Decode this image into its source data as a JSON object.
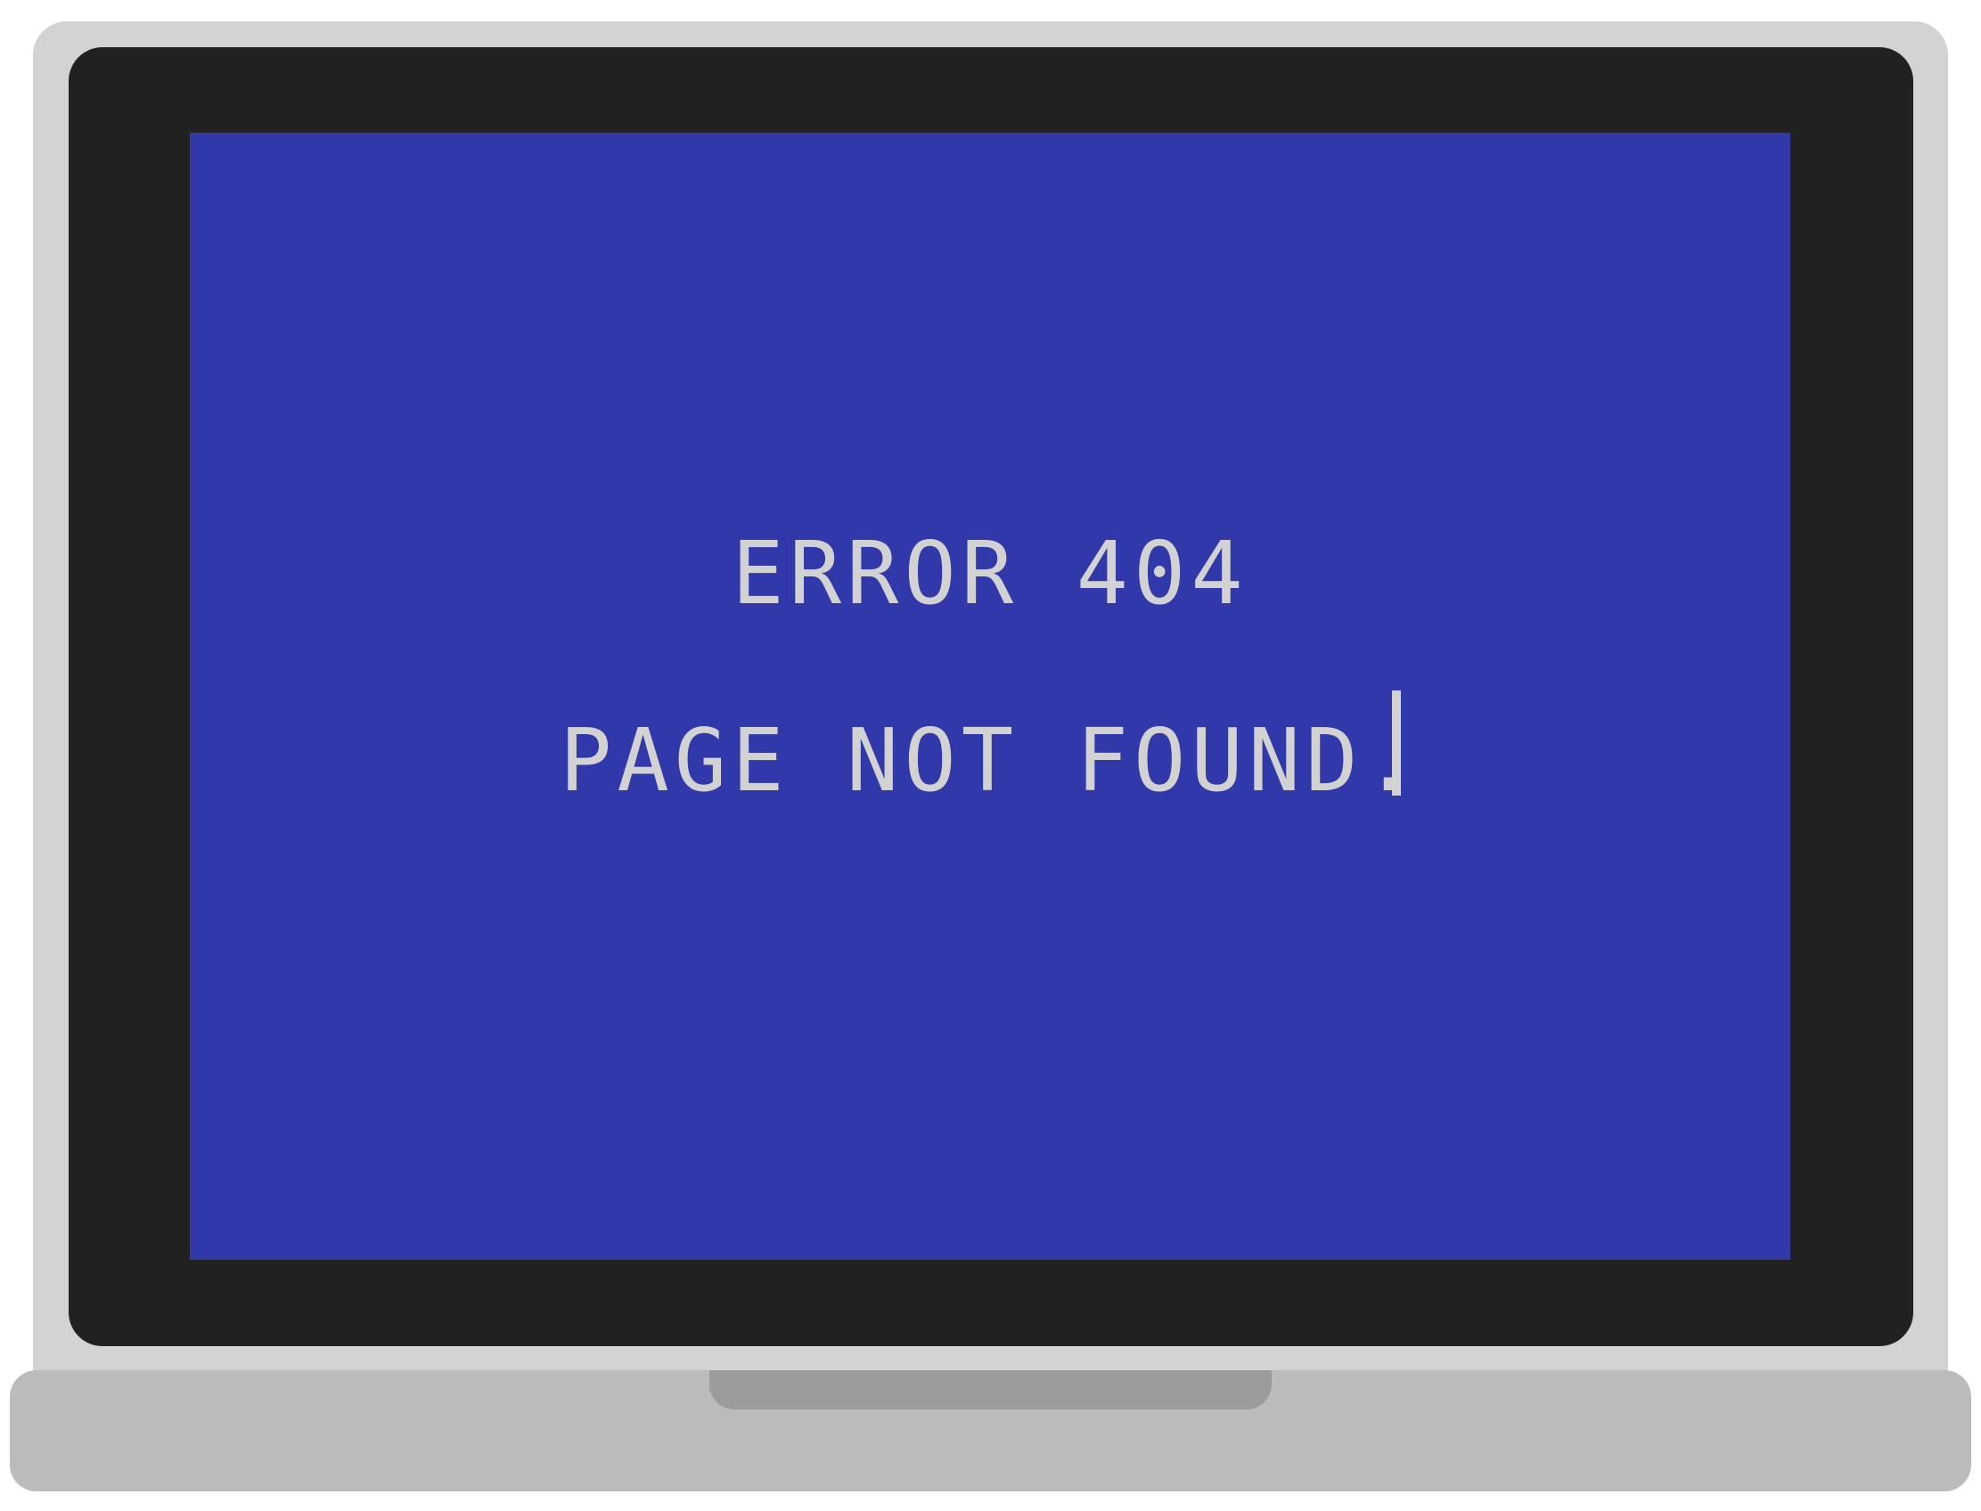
{
  "screen": {
    "error_title": "ERROR 404",
    "error_message": "PAGE NOT FOUND.",
    "background_color": "#3138a9",
    "text_color": "#d2d2d2"
  },
  "device": {
    "type": "laptop",
    "bezel_color": "#212121",
    "shell_color": "#d3d3d3",
    "base_color": "#bbbbbb"
  },
  "icons": {
    "cursor": "text-cursor-icon"
  }
}
